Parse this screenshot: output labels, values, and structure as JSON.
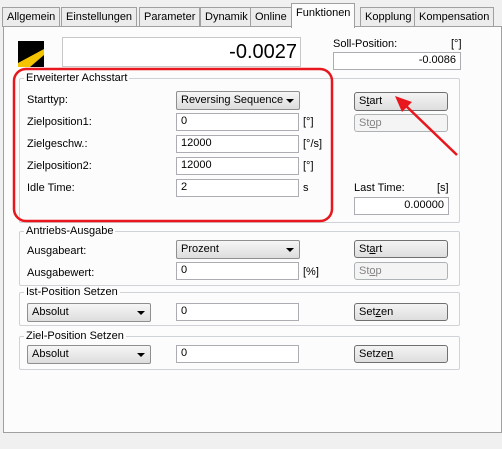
{
  "tabs": [
    {
      "label": "Allgemein",
      "active": false
    },
    {
      "label": "Einstellungen",
      "active": false
    },
    {
      "label": "Parameter",
      "active": false
    },
    {
      "label": "Dynamik",
      "active": false
    },
    {
      "label": "Online",
      "active": false
    },
    {
      "label": "Funktionen",
      "active": true
    },
    {
      "label": "Kopplung",
      "active": false
    },
    {
      "label": "Kompensation",
      "active": false
    }
  ],
  "status": {
    "actual_position": "-0.0027",
    "soll_label": "Soll-Position:",
    "soll_unit": "[°]",
    "soll_value": "-0.0086"
  },
  "erweiterter": {
    "title": "Erweiterter Achsstart",
    "starttyp_label": "Starttyp:",
    "starttyp_value": "Reversing Sequence",
    "zielpos1_label": "Zielposition1:",
    "zielpos1_value": "0",
    "zielpos1_unit": "[°]",
    "zielgeschw_label": "Zielgeschw.:",
    "zielgeschw_value": "12000",
    "zielgeschw_unit": "[°/s]",
    "zielpos2_label": "Zielposition2:",
    "zielpos2_value": "12000",
    "zielpos2_unit": "[°]",
    "idle_label": "Idle Time:",
    "idle_value": "2",
    "idle_unit": "s",
    "start_pre": "S",
    "start_mn": "t",
    "start_post": "art",
    "stop_pre": "St",
    "stop_mn": "o",
    "stop_post": "p",
    "last_time_label": "Last Time:",
    "last_time_unit": "[s]",
    "last_time_value": "0.00000"
  },
  "antrieb": {
    "title": "Antriebs-Ausgabe",
    "ausgabeart_label": "Ausgabeart:",
    "ausgabeart_value": "Prozent",
    "ausgabewert_label": "Ausgabewert:",
    "ausgabewert_value": "0",
    "ausgabewert_unit": "[%]",
    "start_pre": "St",
    "start_mn": "a",
    "start_post": "rt",
    "stop_pre": "St",
    "stop_mn": "o",
    "stop_post": "p"
  },
  "istpos": {
    "title": "Ist-Position Setzen",
    "mode_value": "Absolut",
    "value": "0",
    "set_pre": "Set",
    "set_mn": "z",
    "set_post": "en"
  },
  "zielpos": {
    "title": "Ziel-Position Setzen",
    "mode_value": "Absolut",
    "value": "0",
    "set_pre": "Setze",
    "set_mn": "n",
    "set_post": ""
  },
  "colors": {
    "highlight": "#e8171d",
    "panel_bg": "#fcfcfc",
    "window_bg": "#f0f0f0",
    "logo_yellow": "#f5c400",
    "logo_black": "#000000"
  }
}
